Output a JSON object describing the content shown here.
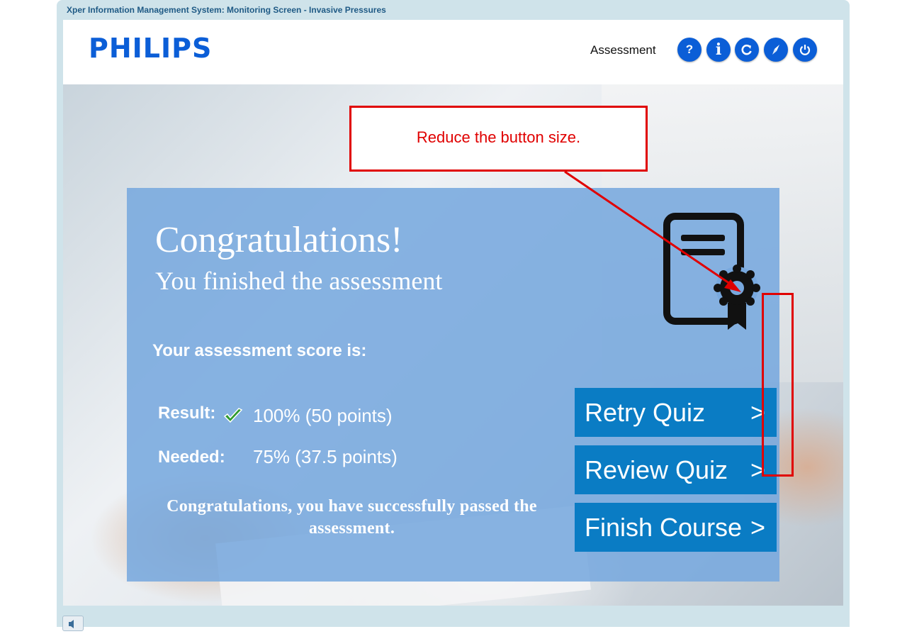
{
  "window": {
    "title": "Xper Information Management System: Monitoring Screen - Invasive Pressures"
  },
  "header": {
    "logo": "PHILIPS",
    "section": "Assessment",
    "buttons": [
      {
        "name": "help-button",
        "icon": "question-icon",
        "glyph": "?"
      },
      {
        "name": "info-button",
        "icon": "info-icon",
        "glyph": "i"
      },
      {
        "name": "refresh-button",
        "icon": "refresh-icon"
      },
      {
        "name": "navigate-button",
        "icon": "compass-icon"
      },
      {
        "name": "exit-button",
        "icon": "power-icon"
      }
    ]
  },
  "result_panel": {
    "heading": "Congratulations!",
    "subheading": "You finished the assessment",
    "score_label": "Your assessment score is:",
    "result_label": "Result:",
    "result_value": "100% (50 points)",
    "needed_label": "Needed:",
    "needed_value": "75% (37.5 points)",
    "pass_message": "Congratulations, you have successfully passed the assessment."
  },
  "actions": [
    {
      "name": "retry-quiz-button",
      "label": "Retry Quiz",
      "arrow": ">"
    },
    {
      "name": "review-quiz-button",
      "label": "Review Quiz",
      "arrow": ">"
    },
    {
      "name": "finish-course-button",
      "label": "Finish Course",
      "arrow": ">"
    }
  ],
  "annotation": {
    "text": "Reduce the button size.",
    "color": "#e00000"
  },
  "colors": {
    "brand": "#0b5ed7",
    "button": "#0a7cc4",
    "panel": "#78a8de"
  }
}
